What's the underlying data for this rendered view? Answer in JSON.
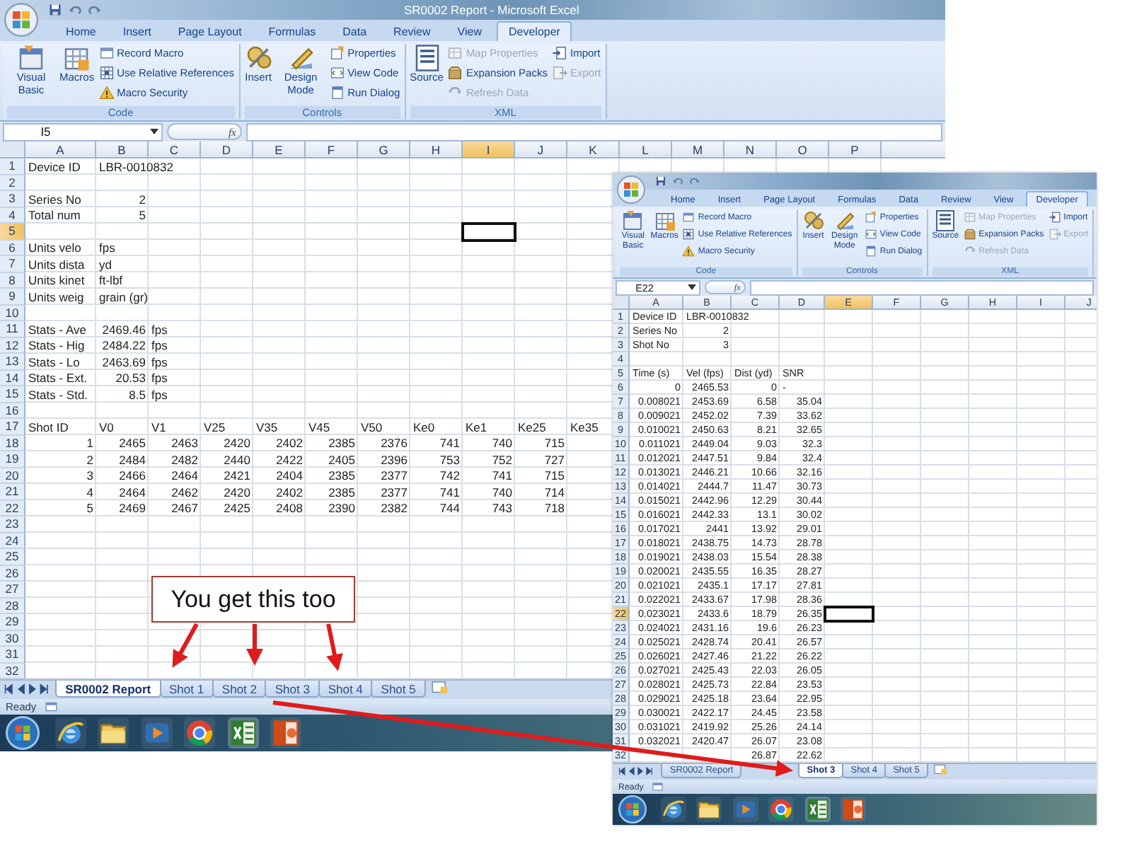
{
  "windows": [
    {
      "title": "SR0002 Report - Microsoft Excel",
      "ribbon_tabs": [
        {
          "label": "Home",
          "selected": false
        },
        {
          "label": "Insert",
          "selected": false
        },
        {
          "label": "Page Layout",
          "selected": false
        },
        {
          "label": "Formulas",
          "selected": false
        },
        {
          "label": "Data",
          "selected": false
        },
        {
          "label": "Review",
          "selected": false
        },
        {
          "label": "View",
          "selected": false
        },
        {
          "label": "Developer",
          "selected": true
        }
      ],
      "ribbon_groups": [
        {
          "label": "Code",
          "items": [
            {
              "kind": "large",
              "label": "Visual Basic",
              "disabled": false
            },
            {
              "kind": "large",
              "label": "Macros",
              "disabled": false
            },
            {
              "kind": "small",
              "label": "Record Macro",
              "disabled": false
            },
            {
              "kind": "small",
              "label": "Use Relative References",
              "disabled": false
            },
            {
              "kind": "small",
              "label": "Macro Security",
              "disabled": false
            }
          ]
        },
        {
          "label": "Controls",
          "items": [
            {
              "kind": "large",
              "label": "Insert",
              "disabled": false
            },
            {
              "kind": "large",
              "label": "Design Mode",
              "disabled": false
            },
            {
              "kind": "small",
              "label": "Properties",
              "disabled": false
            },
            {
              "kind": "small",
              "label": "View Code",
              "disabled": false
            },
            {
              "kind": "small",
              "label": "Run Dialog",
              "disabled": false
            }
          ]
        },
        {
          "label": "XML",
          "items": [
            {
              "kind": "large",
              "label": "Source",
              "disabled": false
            },
            {
              "kind": "small",
              "label": "Map Properties",
              "disabled": true
            },
            {
              "kind": "small",
              "label": "Expansion Packs",
              "disabled": false
            },
            {
              "kind": "small",
              "label": "Refresh Data",
              "disabled": true
            },
            {
              "kind": "small",
              "label": "Import",
              "disabled": false
            },
            {
              "kind": "small",
              "label": "Export",
              "disabled": true
            }
          ]
        }
      ],
      "name_box": "I5",
      "function_button": "fx",
      "columns": [
        {
          "label": "A",
          "selected": false
        },
        {
          "label": "B",
          "selected": false
        },
        {
          "label": "C",
          "selected": false
        },
        {
          "label": "D",
          "selected": false
        },
        {
          "label": "E",
          "selected": false
        },
        {
          "label": "F",
          "selected": false
        },
        {
          "label": "G",
          "selected": false
        },
        {
          "label": "H",
          "selected": false
        },
        {
          "label": "I",
          "selected": true
        },
        {
          "label": "J",
          "selected": false
        },
        {
          "label": "K",
          "selected": false
        },
        {
          "label": "L",
          "selected": false
        },
        {
          "label": "M",
          "selected": false
        },
        {
          "label": "N",
          "selected": false
        },
        {
          "label": "O",
          "selected": false
        },
        {
          "label": "P",
          "selected": false
        }
      ],
      "rows": [
        {
          "number": "1",
          "selected": false,
          "cells": [
            "Device ID",
            "LBR-0010832"
          ]
        },
        {
          "number": "2",
          "selected": false
        },
        {
          "number": "3",
          "selected": false,
          "cells": [
            "Series No",
            "2"
          ]
        },
        {
          "number": "4",
          "selected": false,
          "cells": [
            "Total num",
            "5"
          ]
        },
        {
          "number": "5",
          "selected": true
        },
        {
          "number": "6",
          "selected": false,
          "cells": [
            "Units velo",
            "fps"
          ]
        },
        {
          "number": "7",
          "selected": false,
          "cells": [
            "Units dista",
            "yd"
          ]
        },
        {
          "number": "8",
          "selected": false,
          "cells": [
            "Units kinet",
            "ft-lbf"
          ]
        },
        {
          "number": "9",
          "selected": false,
          "cells": [
            "Units weig",
            "grain (gr)"
          ]
        },
        {
          "number": "10",
          "selected": false
        },
        {
          "number": "11",
          "selected": false,
          "cells": [
            "Stats - Ave",
            "2469.46",
            "fps"
          ]
        },
        {
          "number": "12",
          "selected": false,
          "cells": [
            "Stats - Hig",
            "2484.22",
            "fps"
          ]
        },
        {
          "number": "13",
          "selected": false,
          "cells": [
            "Stats - Lo",
            "2463.69",
            "fps"
          ]
        },
        {
          "number": "14",
          "selected": false,
          "cells": [
            "Stats - Ext.",
            "20.53",
            "fps"
          ]
        },
        {
          "number": "15",
          "selected": false,
          "cells": [
            "Stats - Std.",
            "8.5",
            "fps"
          ]
        },
        {
          "number": "16",
          "selected": false
        },
        {
          "number": "17",
          "selected": false,
          "cells": [
            "Shot ID",
            "V0",
            "V1",
            "V25",
            "V35",
            "V45",
            "V50",
            "Ke0",
            "Ke1",
            "Ke25",
            "Ke35"
          ]
        },
        {
          "number": "18",
          "selected": false,
          "cells": [
            "1",
            "2465",
            "2463",
            "2420",
            "2402",
            "2385",
            "2376",
            "741",
            "740",
            "715"
          ]
        },
        {
          "number": "19",
          "selected": false,
          "cells": [
            "2",
            "2484",
            "2482",
            "2440",
            "2422",
            "2405",
            "2396",
            "753",
            "752",
            "727"
          ]
        },
        {
          "number": "20",
          "selected": false,
          "cells": [
            "3",
            "2466",
            "2464",
            "2421",
            "2404",
            "2385",
            "2377",
            "742",
            "741",
            "715"
          ]
        },
        {
          "number": "21",
          "selected": false,
          "cells": [
            "4",
            "2464",
            "2462",
            "2420",
            "2402",
            "2385",
            "2377",
            "741",
            "740",
            "714"
          ]
        },
        {
          "number": "22",
          "selected": false,
          "cells": [
            "5",
            "2469",
            "2467",
            "2425",
            "2408",
            "2390",
            "2382",
            "744",
            "743",
            "718"
          ]
        },
        {
          "number": "23",
          "selected": false
        },
        {
          "number": "24",
          "selected": false
        },
        {
          "number": "25",
          "selected": false
        },
        {
          "number": "26",
          "selected": false
        },
        {
          "number": "27",
          "selected": false
        },
        {
          "number": "28",
          "selected": false
        },
        {
          "number": "29",
          "selected": false
        },
        {
          "number": "30",
          "selected": false
        },
        {
          "number": "31",
          "selected": false
        },
        {
          "number": "32",
          "selected": false
        }
      ],
      "sheet_tabs": [
        {
          "label": "SR0002 Report",
          "selected": true
        },
        {
          "label": "Shot 1",
          "selected": false
        },
        {
          "label": "Shot 2",
          "selected": false
        },
        {
          "label": "Shot 3",
          "selected": false
        },
        {
          "label": "Shot 4",
          "selected": false
        },
        {
          "label": "Shot 5",
          "selected": false
        }
      ],
      "status": "Ready"
    },
    {
      "ribbon_tabs": [
        {
          "label": "Home",
          "selected": false
        },
        {
          "label": "Insert",
          "selected": false
        },
        {
          "label": "Page Layout",
          "selected": false
        },
        {
          "label": "Formulas",
          "selected": false
        },
        {
          "label": "Data",
          "selected": false
        },
        {
          "label": "Review",
          "selected": false
        },
        {
          "label": "View",
          "selected": false
        },
        {
          "label": "Developer",
          "selected": true
        }
      ],
      "ribbon_groups": [
        {
          "label": "Code",
          "items": [
            {
              "kind": "large",
              "label": "Visual Basic",
              "disabled": false
            },
            {
              "kind": "large",
              "label": "Macros",
              "disabled": false
            },
            {
              "kind": "small",
              "label": "Record Macro",
              "disabled": false
            },
            {
              "kind": "small",
              "label": "Use Relative References",
              "disabled": false
            },
            {
              "kind": "small",
              "label": "Macro Security",
              "disabled": false
            }
          ]
        },
        {
          "label": "Controls",
          "items": [
            {
              "kind": "large",
              "label": "Insert",
              "disabled": false
            },
            {
              "kind": "large",
              "label": "Design Mode",
              "disabled": false
            },
            {
              "kind": "small",
              "label": "Properties",
              "disabled": false
            },
            {
              "kind": "small",
              "label": "View Code",
              "disabled": false
            },
            {
              "kind": "small",
              "label": "Run Dialog",
              "disabled": false
            }
          ]
        },
        {
          "label": "XML",
          "items": [
            {
              "kind": "large",
              "label": "Source",
              "disabled": false
            },
            {
              "kind": "small",
              "label": "Map Properties",
              "disabled": true
            },
            {
              "kind": "small",
              "label": "Expansion Packs",
              "disabled": false
            },
            {
              "kind": "small",
              "label": "Refresh Data",
              "disabled": true
            },
            {
              "kind": "small",
              "label": "Import",
              "disabled": false
            },
            {
              "kind": "small",
              "label": "Export",
              "disabled": true
            }
          ]
        }
      ],
      "name_box": "E22",
      "function_button": "fx",
      "columns": [
        {
          "label": "A",
          "selected": false
        },
        {
          "label": "B",
          "selected": false
        },
        {
          "label": "C",
          "selected": false
        },
        {
          "label": "D",
          "selected": false
        },
        {
          "label": "E",
          "selected": true
        },
        {
          "label": "F",
          "selected": false
        },
        {
          "label": "G",
          "selected": false
        },
        {
          "label": "H",
          "selected": false
        },
        {
          "label": "I",
          "selected": false
        },
        {
          "label": "J",
          "selected": false
        }
      ],
      "rows": [
        {
          "number": "1",
          "selected": false,
          "cells": [
            "Device ID",
            "LBR-0010832"
          ]
        },
        {
          "number": "2",
          "selected": false,
          "cells": [
            "Series No",
            "2"
          ]
        },
        {
          "number": "3",
          "selected": false,
          "cells": [
            "Shot No",
            "3"
          ]
        },
        {
          "number": "4",
          "selected": false
        },
        {
          "number": "5",
          "selected": false,
          "cells": [
            "Time (s)",
            "Vel (fps)",
            "Dist (yd)",
            "SNR"
          ]
        },
        {
          "number": "6",
          "selected": false,
          "cells": [
            "0",
            "2465.53",
            "0",
            "-"
          ]
        },
        {
          "number": "7",
          "selected": false,
          "cells": [
            "0.008021",
            "2453.69",
            "6.58",
            "35.04"
          ]
        },
        {
          "number": "8",
          "selected": false,
          "cells": [
            "0.009021",
            "2452.02",
            "7.39",
            "33.62"
          ]
        },
        {
          "number": "9",
          "selected": false,
          "cells": [
            "0.010021",
            "2450.63",
            "8.21",
            "32.65"
          ]
        },
        {
          "number": "10",
          "selected": false,
          "cells": [
            "0.011021",
            "2449.04",
            "9.03",
            "32.3"
          ]
        },
        {
          "number": "11",
          "selected": false,
          "cells": [
            "0.012021",
            "2447.51",
            "9.84",
            "32.4"
          ]
        },
        {
          "number": "12",
          "selected": false,
          "cells": [
            "0.013021",
            "2446.21",
            "10.66",
            "32.16"
          ]
        },
        {
          "number": "13",
          "selected": false,
          "cells": [
            "0.014021",
            "2444.7",
            "11.47",
            "30.73"
          ]
        },
        {
          "number": "14",
          "selected": false,
          "cells": [
            "0.015021",
            "2442.96",
            "12.29",
            "30.44"
          ]
        },
        {
          "number": "15",
          "selected": false,
          "cells": [
            "0.016021",
            "2442.33",
            "13.1",
            "30.02"
          ]
        },
        {
          "number": "16",
          "selected": false,
          "cells": [
            "0.017021",
            "2441",
            "13.92",
            "29.01"
          ]
        },
        {
          "number": "17",
          "selected": false,
          "cells": [
            "0.018021",
            "2438.75",
            "14.73",
            "28.78"
          ]
        },
        {
          "number": "18",
          "selected": false,
          "cells": [
            "0.019021",
            "2438.03",
            "15.54",
            "28.38"
          ]
        },
        {
          "number": "19",
          "selected": false,
          "cells": [
            "0.020021",
            "2435.55",
            "16.35",
            "28.27"
          ]
        },
        {
          "number": "20",
          "selected": false,
          "cells": [
            "0.021021",
            "2435.1",
            "17.17",
            "27.81"
          ]
        },
        {
          "number": "21",
          "selected": false,
          "cells": [
            "0.022021",
            "2433.67",
            "17.98",
            "28.36"
          ]
        },
        {
          "number": "22",
          "selected": true,
          "cells": [
            "0.023021",
            "2433.6",
            "18.79",
            "26.35"
          ]
        },
        {
          "number": "23",
          "selected": false,
          "cells": [
            "0.024021",
            "2431.16",
            "19.6",
            "26.23"
          ]
        },
        {
          "number": "24",
          "selected": false,
          "cells": [
            "0.025021",
            "2428.74",
            "20.41",
            "26.57"
          ]
        },
        {
          "number": "25",
          "selected": false,
          "cells": [
            "0.026021",
            "2427.46",
            "21.22",
            "26.22"
          ]
        },
        {
          "number": "26",
          "selected": false,
          "cells": [
            "0.027021",
            "2425.43",
            "22.03",
            "26.05"
          ]
        },
        {
          "number": "27",
          "selected": false,
          "cells": [
            "0.028021",
            "2425.73",
            "22.84",
            "23.53"
          ]
        },
        {
          "number": "28",
          "selected": false,
          "cells": [
            "0.029021",
            "2425.18",
            "23.64",
            "22.95"
          ]
        },
        {
          "number": "29",
          "selected": false,
          "cells": [
            "0.030021",
            "2422.17",
            "24.45",
            "23.58"
          ]
        },
        {
          "number": "30",
          "selected": false,
          "cells": [
            "0.031021",
            "2419.92",
            "25.26",
            "24.14"
          ]
        },
        {
          "number": "31",
          "selected": false,
          "cells": [
            "0.032021",
            "2420.47",
            "26.07",
            "23.08"
          ]
        },
        {
          "number": "32",
          "selected": false,
          "cells": [
            null,
            null,
            "26.87",
            "22.62"
          ]
        }
      ],
      "sheet_tabs": [
        {
          "label": "SR0002 Report",
          "selected": false
        },
        {
          "label": "Shot 3",
          "selected": true
        },
        {
          "label": "Shot 4",
          "selected": false
        },
        {
          "label": "Shot 5",
          "selected": false
        }
      ],
      "status": "Ready"
    }
  ],
  "annotation": {
    "callout": "You get this too"
  }
}
